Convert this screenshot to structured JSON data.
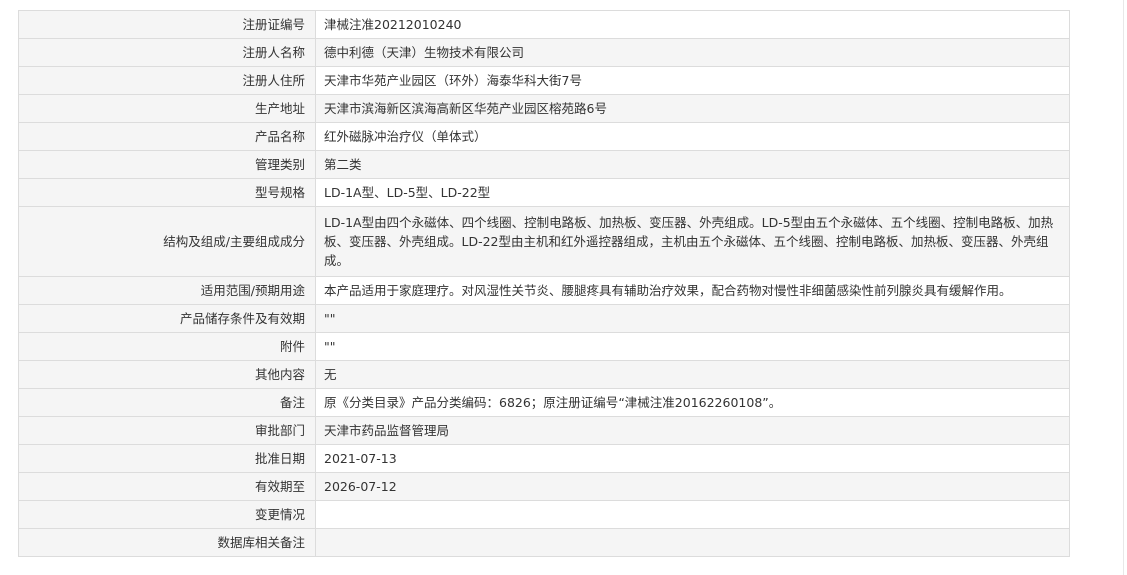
{
  "rows": [
    {
      "label": "注册证编号",
      "value": "津械注准20212010240"
    },
    {
      "label": "注册人名称",
      "value": "德中利德（天津）生物技术有限公司"
    },
    {
      "label": "注册人住所",
      "value": "天津市华苑产业园区（环外）海泰华科大街7号"
    },
    {
      "label": "生产地址",
      "value": "天津市滨海新区滨海高新区华苑产业园区榕苑路6号"
    },
    {
      "label": "产品名称",
      "value": "红外磁脉冲治疗仪（单体式）"
    },
    {
      "label": "管理类别",
      "value": "第二类"
    },
    {
      "label": "型号规格",
      "value": "LD-1A型、LD-5型、LD-22型"
    },
    {
      "label": "结构及组成/主要组成成分",
      "value": "LD-1A型由四个永磁体、四个线圈、控制电路板、加热板、变压器、外壳组成。LD-5型由五个永磁体、五个线圈、控制电路板、加热板、变压器、外壳组成。LD-22型由主机和红外遥控器组成，主机由五个永磁体、五个线圈、控制电路板、加热板、变压器、外壳组成。"
    },
    {
      "label": "适用范围/预期用途",
      "value": "本产品适用于家庭理疗。对风湿性关节炎、腰腿疼具有辅助治疗效果，配合药物对慢性非细菌感染性前列腺炎具有缓解作用。"
    },
    {
      "label": "产品储存条件及有效期",
      "value": "\"\""
    },
    {
      "label": "附件",
      "value": "\"\""
    },
    {
      "label": "其他内容",
      "value": "无"
    },
    {
      "label": "备注",
      "value": "原《分类目录》产品分类编码：6826；原注册证编号“津械注准20162260108”。"
    },
    {
      "label": "审批部门",
      "value": "天津市药品监督管理局"
    },
    {
      "label": "批准日期",
      "value": "2021-07-13"
    },
    {
      "label": "有效期至",
      "value": "2026-07-12"
    },
    {
      "label": "变更情况",
      "value": ""
    },
    {
      "label": "数据库相关备注",
      "value": ""
    }
  ]
}
